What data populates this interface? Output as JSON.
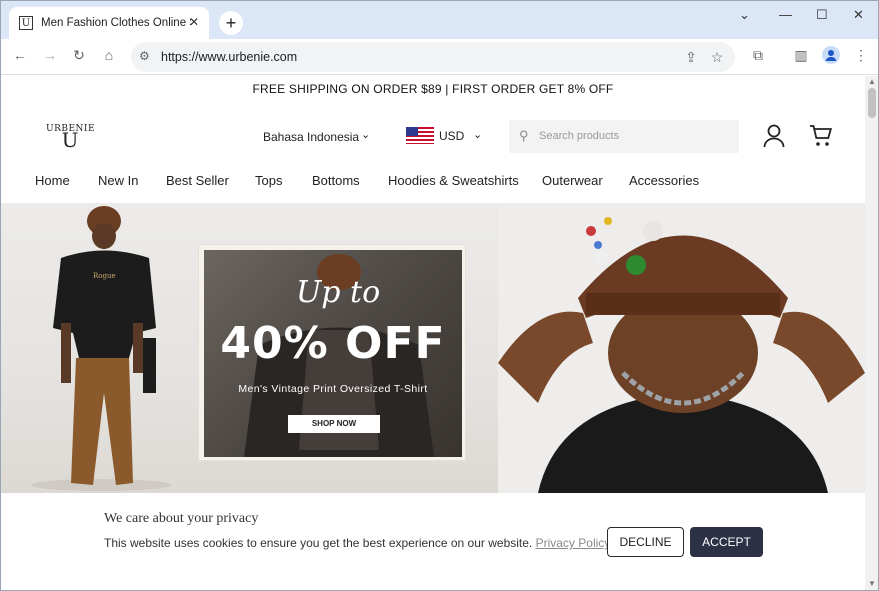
{
  "browser": {
    "tab_title": "Men Fashion Clothes Online Sh",
    "tab_favicon_letter": "U",
    "url": "https://www.urbenie.com"
  },
  "site": {
    "announcement": "FREE SHIPPING ON ORDER $89 | FIRST ORDER GET 8% OFF",
    "logo_text": "URBENIE",
    "logo_mark": "U",
    "language": "Bahasa Indonesia",
    "currency": "USD",
    "search_placeholder": "Search products",
    "nav": [
      "Home",
      "New In",
      "Best Seller",
      "Tops",
      "Bottoms",
      "Hoodies & Sweatshirts",
      "Outerwear",
      "Accessories"
    ]
  },
  "banner": {
    "headline_script": "Up to",
    "headline_big": "40% OFF",
    "subtitle": "Men's Vintage Print Oversized T-Shirt",
    "cta": "SHOP NOW"
  },
  "cookie": {
    "title": "We care about your privacy",
    "text": "This website uses cookies to ensure you get the best experience on our website.",
    "link": "Privacy Policy",
    "decline": "DECLINE",
    "accept": "ACCEPT"
  }
}
